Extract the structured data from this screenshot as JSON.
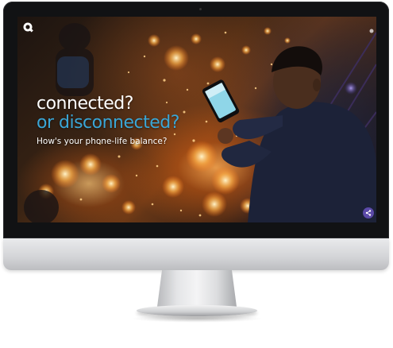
{
  "hero": {
    "headline_line1": "connected?",
    "headline_line2": "or disconnected?",
    "subheadline": "How's your phone-life balance?"
  },
  "icons": {
    "brand_logo": "quint-q-logo-icon",
    "share": "share-icon"
  },
  "colors": {
    "headline_primary": "#ffffff",
    "headline_accent": "#3aa6d6",
    "share_button": "#5b4aa8",
    "monitor_bezel": "#111214"
  }
}
